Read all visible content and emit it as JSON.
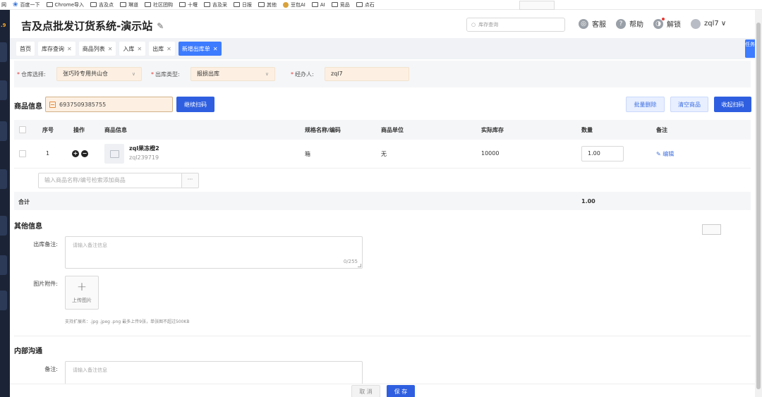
{
  "bookmarks": {
    "first": "网",
    "items": [
      {
        "label": "百度一下",
        "icon": "paw-icon"
      },
      {
        "label": "Chrome导入",
        "icon": "folder-icon"
      },
      {
        "label": "吉及点",
        "icon": "folder-icon"
      },
      {
        "label": "琳道",
        "icon": "folder-icon"
      },
      {
        "label": "社区团购",
        "icon": "folder-icon"
      },
      {
        "label": "十堰",
        "icon": "folder-icon"
      },
      {
        "label": "吉及采",
        "icon": "folder-icon"
      },
      {
        "label": "日报",
        "icon": "folder-icon"
      },
      {
        "label": "其他",
        "icon": "folder-icon"
      },
      {
        "label": "豆包AI",
        "icon": "doubao-icon"
      },
      {
        "label": "AI",
        "icon": "folder-icon"
      },
      {
        "label": "竞品",
        "icon": "folder-icon"
      },
      {
        "label": "点石",
        "icon": "folder-icon"
      }
    ]
  },
  "rail": {
    "version": ".9"
  },
  "header": {
    "title": "吉及点批发订货系统-演示站",
    "search_placeholder": "库存查询",
    "actions": {
      "service": "客服",
      "help": "帮助",
      "unlock": "解锁",
      "user": "zql7 ∨"
    }
  },
  "tabs": [
    {
      "label": "首页",
      "closable": false,
      "active": false
    },
    {
      "label": "库存查询",
      "closable": true,
      "active": false
    },
    {
      "label": "商品列表",
      "closable": true,
      "active": false
    },
    {
      "label": "入库",
      "closable": true,
      "active": false
    },
    {
      "label": "出库",
      "closable": true,
      "active": false
    },
    {
      "label": "新增出库单",
      "closable": true,
      "active": true
    }
  ],
  "side_task": "任务",
  "filters": {
    "warehouse_label": "仓库选择:",
    "warehouse_value": "张巧玲专用共山仓",
    "type_label": "出库类型:",
    "type_value": "报损出库",
    "handler_label": "经办人:",
    "handler_value": "zql7"
  },
  "product_section": {
    "title": "商品信息",
    "scan_value": "6937509385755",
    "continue_scan": "继续扫码",
    "batch_delete": "批量删除",
    "clear_products": "清空商品",
    "collapse_scan": "收起扫码"
  },
  "table": {
    "headers": {
      "index": "序号",
      "op": "操作",
      "info": "商品信息",
      "spec": "规格名称/编码",
      "unit": "商品单位",
      "stock": "实际库存",
      "qty": "数量",
      "remark": "备注"
    },
    "rows": [
      {
        "index": "1",
        "name": "zql果冻橙2",
        "code": "zql239719",
        "spec": "箱",
        "unit": "无",
        "stock": "10000",
        "qty": "1.00",
        "remark": "编辑"
      }
    ],
    "add_placeholder": "输入商品名称/编号检索添加商品",
    "add_more": "···",
    "total_label": "合计",
    "total_qty": "1.00"
  },
  "other_section": {
    "title": "其他信息",
    "remark_label": "出库备注:",
    "remark_placeholder": "请输入备注信息",
    "remark_counter": "0/255",
    "image_label": "图片附件:",
    "upload_label": "上传图片",
    "hint": "支持扩展名：.jpg .jpeg .png 最多上传9张，单张图不超过500KB"
  },
  "internal_section": {
    "title": "内部沟通",
    "remark_label": "备注:",
    "remark_placeholder": "请输入备注信息"
  },
  "footer": {
    "cancel": "取 消",
    "save": "保 存"
  },
  "colors": {
    "primary": "#2f5fe0",
    "tab_active": "#3d7bff",
    "input_highlight": "#fdf0e2",
    "rail": "#1b2336"
  }
}
